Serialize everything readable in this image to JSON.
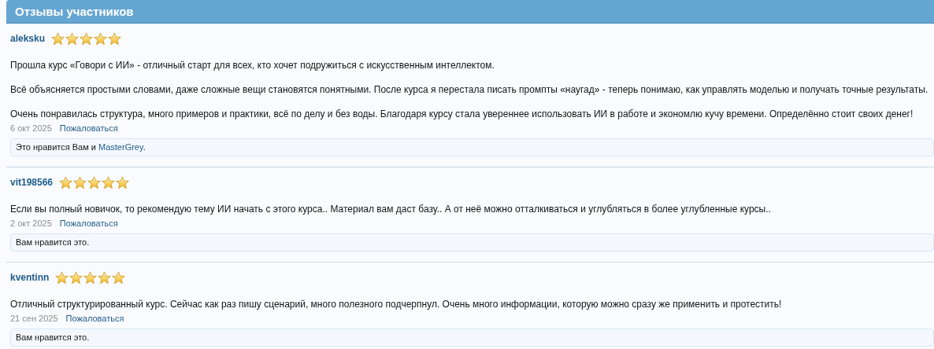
{
  "header": {
    "title": "Отзывы участников"
  },
  "reviews": [
    {
      "author": "aleksku",
      "stars": 5,
      "paragraphs": [
        "Прошла курс «Говори с ИИ» - отличный старт для всех, кто хочет подружиться с искусственным интеллектом.",
        "Всё объясняется простыми словами, даже сложные вещи становятся понятными. После курса я перестала писать промпты «наугад» - теперь понимаю, как управлять моделью и получать точные результаты.",
        "Очень понравилась структура, много примеров и практики, всё по делу и без воды. Благодаря курсу стала увереннее использовать ИИ в работе и экономлю кучу времени. Определённо стоит своих денег!"
      ],
      "date": "6 окт 2025",
      "report": "Пожаловаться",
      "likes": {
        "text": "Это нравится Вам и",
        "link": "MasterGrey",
        "end": "."
      }
    },
    {
      "author": "vit198566",
      "stars": 5,
      "paragraphs": [
        "Если вы полный новичок, то рекомендую тему ИИ начать с этого курса.. Материал вам даст базу.. А от неё можно отталкиваться и углубляться в более углубленные курсы.."
      ],
      "date": "2 окт 2025",
      "report": "Пожаловаться",
      "likes": {
        "text": "Вам нравится это."
      }
    },
    {
      "author": "kventinn",
      "stars": 5,
      "paragraphs": [
        "Отличный структурированный курс. Сейчас как раз пишу сценарий, много полезного подчерпнул. Очень много информации, которую можно сразу же применить и протестить!"
      ],
      "date": "21 сен 2025",
      "report": "Пожаловаться",
      "likes": {
        "text": "Вам нравится это."
      }
    }
  ]
}
